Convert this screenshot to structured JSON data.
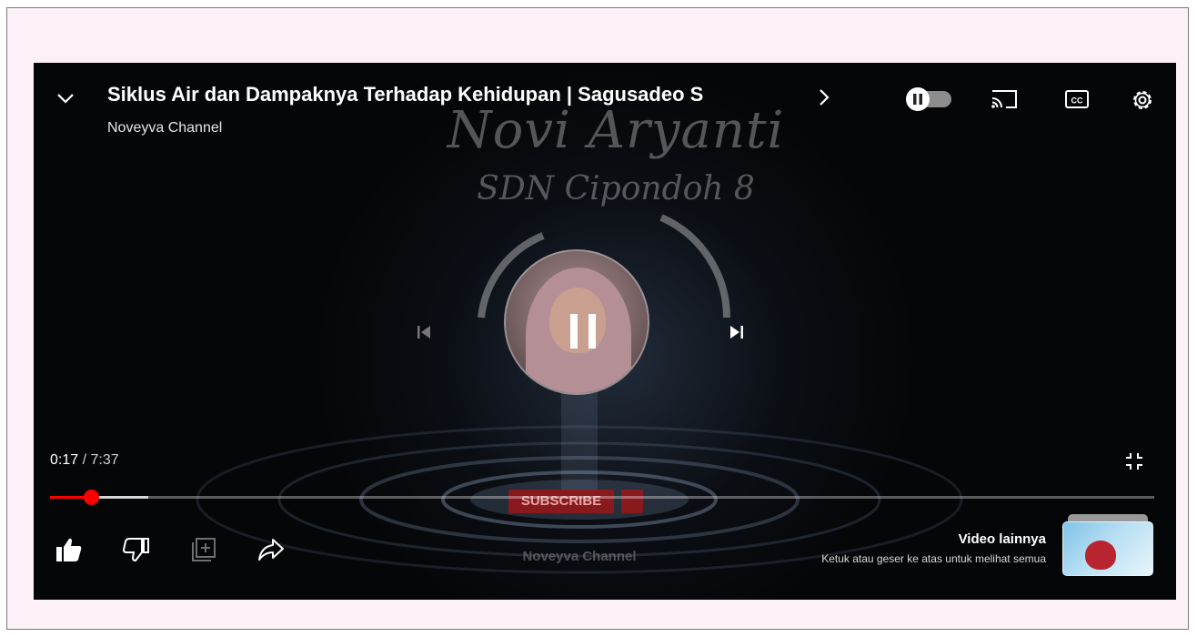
{
  "player": {
    "title": "Siklus Air dan Dampaknya Terhadap Kehidupan | Sagusadeo S",
    "channel": "Noveyva Channel",
    "current_time": "0:17",
    "separator": " / ",
    "duration": "7:37",
    "progress_played": 0.037,
    "progress_buffered": 0.089,
    "autoplay_enabled": true
  },
  "video_frame": {
    "watermark_name": "Novi Aryanti",
    "watermark_school": "SDN Cipondoh 8",
    "watermark_subscribe": "SUBSCRIBE",
    "watermark_channel": "Noveyva Channel"
  },
  "more_videos": {
    "title": "Video lainnya",
    "hint": "Ketuk atau geser ke atas untuk melihat semua"
  },
  "icons": {
    "collapse": "chevron-down-icon",
    "next_title": "chevron-right-icon",
    "autoplay": "autoplay-toggle",
    "cast": "cast-icon",
    "captions": "cc-icon",
    "settings": "gear-icon",
    "prev": "skip-previous-icon",
    "play_pause": "pause-icon",
    "next": "skip-next-icon",
    "exit_fullscreen": "exit-fullscreen-icon",
    "like": "thumbs-up-icon",
    "dislike": "thumbs-down-icon",
    "save": "save-playlist-icon",
    "share": "share-icon"
  },
  "colors": {
    "accent": "#ff0000",
    "page_bg": "#fdf1f8",
    "player_bg": "#050608"
  }
}
